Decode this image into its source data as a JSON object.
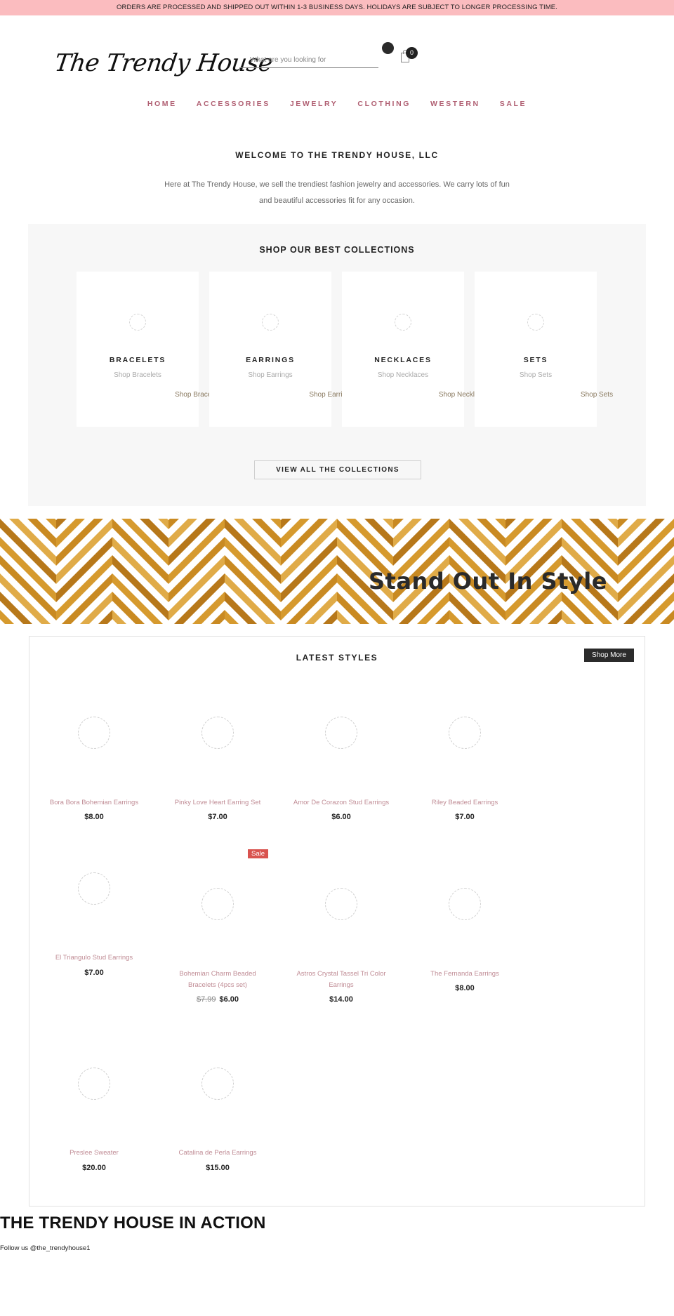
{
  "announcement": "ORDERS ARE PROCESSED AND SHIPPED OUT WITHIN 1-3 BUSINESS DAYS. HOLIDAYS ARE SUBJECT TO LONGER PROCESSING TIME.",
  "header": {
    "logo": "The Trendy House",
    "search_placeholder": "What are you looking for",
    "cart_count": "0"
  },
  "nav": [
    "HOME",
    "ACCESSORIES",
    "JEWELRY",
    "CLOTHING",
    "WESTERN",
    "SALE"
  ],
  "welcome": {
    "title": "WELCOME TO THE TRENDY HOUSE, LLC",
    "text": "Here at The Trendy House, we sell the trendiest fashion jewelry and accessories. We carry lots of fun and beautiful accessories fit for any occasion."
  },
  "collections": {
    "title": "SHOP OUR BEST COLLECTIONS",
    "items": [
      {
        "title": "BRACELETS",
        "subtitle": "Shop Bracelets",
        "link": "Shop Bracelets"
      },
      {
        "title": "EARRINGS",
        "subtitle": "Shop Earrings",
        "link": "Shop Earrings"
      },
      {
        "title": "NECKLACES",
        "subtitle": "Shop Necklaces",
        "link": "Shop Necklaces"
      },
      {
        "title": "SETS",
        "subtitle": "Shop Sets",
        "link": "Shop Sets"
      }
    ],
    "view_all": "VIEW ALL THE COLLECTIONS"
  },
  "banner": {
    "title": "Stand Out In Style"
  },
  "latest": {
    "title": "LATEST STYLES",
    "shop_more": "Shop More",
    "products": [
      {
        "name": "Bora Bora Bohemian Earrings",
        "price": "$8.00"
      },
      {
        "name": "Pinky Love Heart Earring Set",
        "price": "$7.00"
      },
      {
        "name": "Amor De Corazon Stud Earrings",
        "price": "$6.00"
      },
      {
        "name": "Riley Beaded Earrings",
        "price": "$7.00"
      },
      {
        "name": "El Triangulo Stud Earrings",
        "price": "$7.00"
      },
      {
        "name": "Bohemian Charm Beaded Bracelets (4pcs set)",
        "price": "$6.00",
        "compare_price": "$7.99",
        "badge": "Sale"
      },
      {
        "name": "Astros Crystal Tassel Tri Color Earrings",
        "price": "$14.00"
      },
      {
        "name": "The Fernanda Earrings",
        "price": "$8.00"
      },
      {
        "name": "Preslee Sweater",
        "price": "$20.00"
      },
      {
        "name": "Catalina de Perla Earrings",
        "price": "$15.00"
      }
    ]
  },
  "instagram": {
    "title": "THE TRENDY HOUSE IN ACTION",
    "follow": "Follow us @the_trendyhouse1"
  },
  "colors": {
    "announcement_bg": "#fbbcbf",
    "nav_text": "#b05f72",
    "product_name": "#c08c95",
    "sale_badge": "#d9534f",
    "banner_gold": "#c98a22"
  }
}
